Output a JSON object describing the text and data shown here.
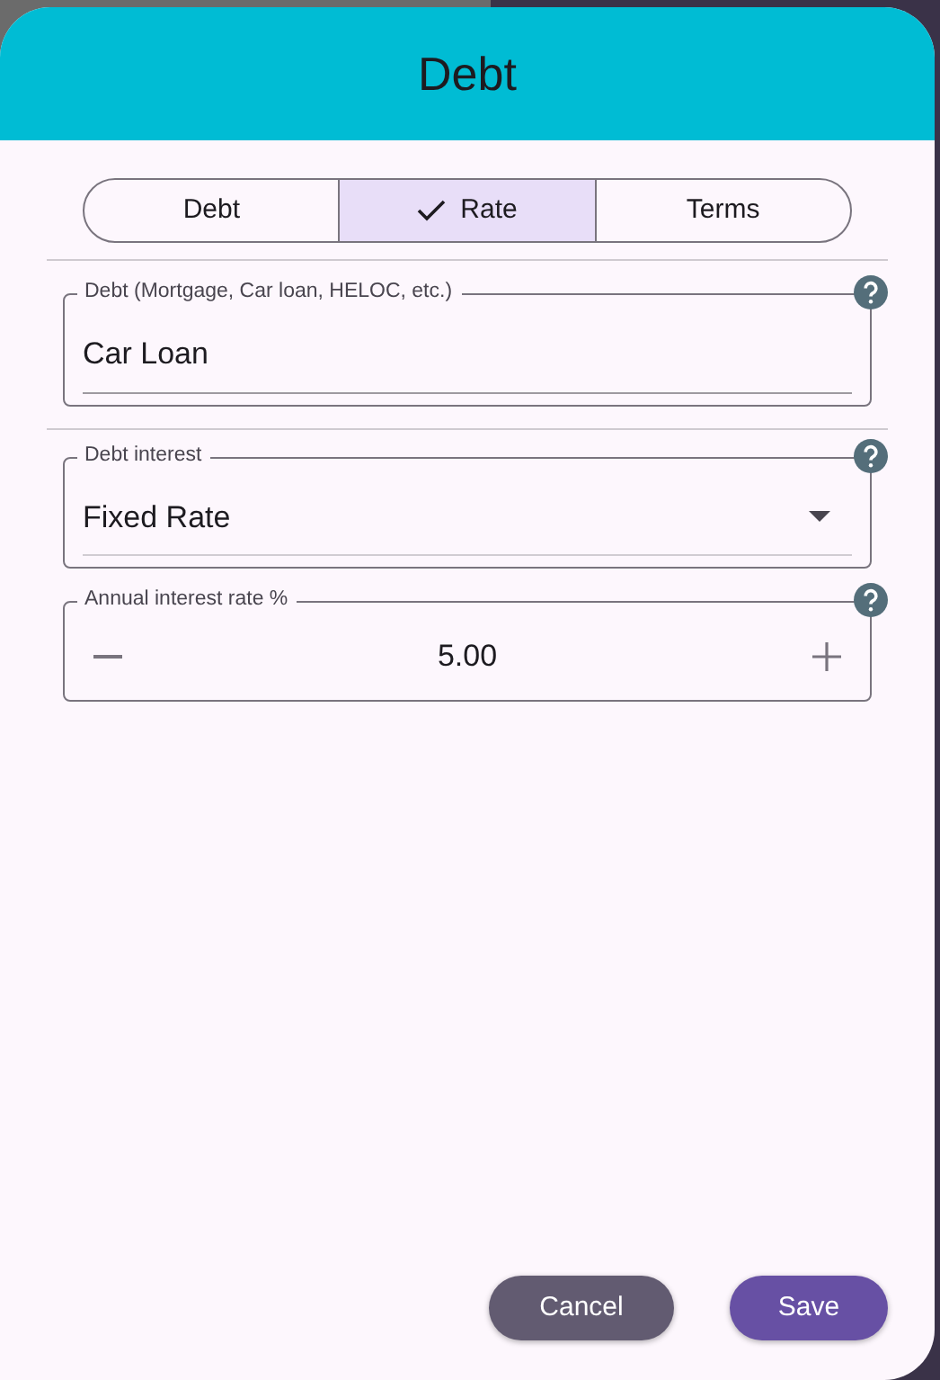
{
  "dialog": {
    "title": "Debt"
  },
  "tabs": [
    {
      "label": "Debt",
      "selected": false
    },
    {
      "label": "Rate",
      "selected": true
    },
    {
      "label": "Terms",
      "selected": false
    }
  ],
  "fields": [
    {
      "kind": "text",
      "label": "Debt (Mortgage, Car loan, HELOC, etc.)",
      "value": "Car Loan",
      "divider_after": true
    },
    {
      "kind": "select",
      "label": "Debt interest",
      "value": "Fixed Rate",
      "divider_after": false
    },
    {
      "kind": "stepper",
      "label": "Annual interest rate %",
      "value": "5.00",
      "divider_after": false
    }
  ],
  "buttons": [
    {
      "label": "Cancel",
      "kind": "secondary"
    },
    {
      "label": "Save",
      "kind": "primary"
    }
  ]
}
